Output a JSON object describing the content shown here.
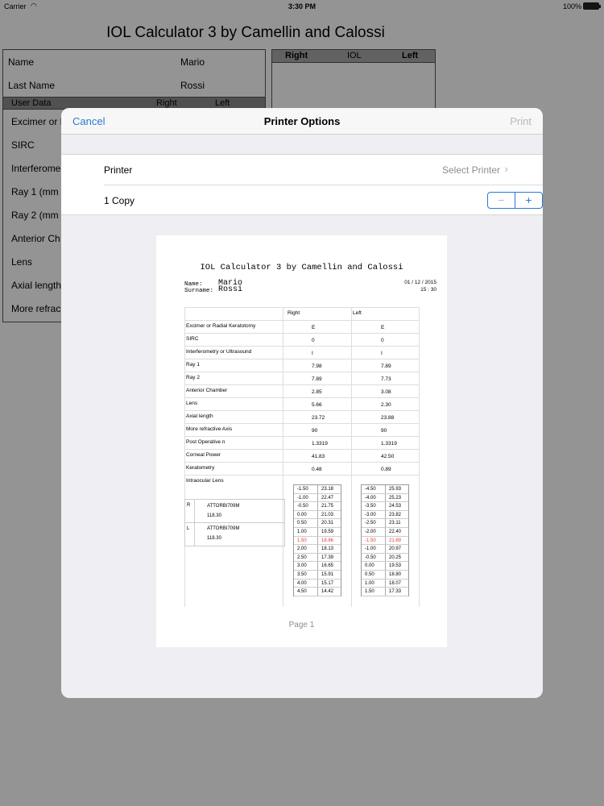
{
  "status": {
    "carrier": "Carrier",
    "time": "3:30 PM",
    "battery": "100%"
  },
  "app": {
    "title": "IOL Calculator 3 by Camellin and Calossi",
    "name_label": "Name",
    "name_value": "Mario",
    "lastname_label": "Last Name",
    "lastname_value": "Rossi",
    "header": {
      "user_data": "User Data",
      "right": "Right",
      "left": "Left"
    },
    "right_header": {
      "right": "Right",
      "iol": "IOL",
      "left": "Left"
    },
    "items": [
      "Excimer or R",
      "SIRC",
      "Interferome",
      "Ray 1 (mm",
      "Ray 2 (mm",
      "Anterior Ch",
      "Lens",
      "Axial length",
      "More refrac"
    ]
  },
  "modal": {
    "cancel": "Cancel",
    "title": "Printer Options",
    "print": "Print",
    "printer_label": "Printer",
    "printer_value": "Select Printer",
    "copies_label": "1 Copy",
    "minus": "−",
    "plus": "+"
  },
  "preview": {
    "title": "IOL Calculator 3 by Camellin and Calossi",
    "name_label": "Name:",
    "name_value": "Mario",
    "surname_label": "Surname:",
    "surname_value": "Rossi",
    "date": "01 / 12 / 2015",
    "time": "15 : 30",
    "col_right": "Right",
    "col_left": "Left",
    "rows": [
      {
        "name": "Excimer or Radial Keratotomy",
        "right": "E",
        "left": "E"
      },
      {
        "name": "SIRC",
        "right": "0",
        "left": "0"
      },
      {
        "name": "Interferometry or Ultrasound",
        "right": "I",
        "left": "I"
      },
      {
        "name": "Ray 1",
        "right": "7.98",
        "left": "7.89"
      },
      {
        "name": "Ray 2",
        "right": "7.89",
        "left": "7.73"
      },
      {
        "name": "Anterior Chamber",
        "right": "2.85",
        "left": "3.08"
      },
      {
        "name": "Lens",
        "right": "5.66",
        "left": "2.30"
      },
      {
        "name": "Axial length",
        "right": "23.72",
        "left": "23.88"
      },
      {
        "name": "More refractive Axis",
        "right": "90",
        "left": "90"
      },
      {
        "name": "Post Operative n",
        "right": "1.3319",
        "left": "1.3319"
      },
      {
        "name": "Corneal Power",
        "right": "41.83",
        "left": "42.50"
      },
      {
        "name": "Keratometry",
        "right": "0.48",
        "left": "0.89"
      }
    ],
    "iol_label": "Intraocular Lens",
    "lens_r_side": "R",
    "lens_r_name": "ATTORBI709M",
    "lens_r_value": "118.30",
    "lens_l_side": "L",
    "lens_l_name": "ATTORBI709M",
    "lens_l_value": "118.30",
    "right_table": [
      [
        "-1.50",
        "23.18"
      ],
      [
        "-1.00",
        "22.47"
      ],
      [
        "-0.50",
        "21.75"
      ],
      [
        "0.00",
        "21.03"
      ],
      [
        "0.50",
        "20.31"
      ],
      [
        "1.00",
        "19.59"
      ],
      [
        "1.50",
        "18.86"
      ],
      [
        "2.00",
        "18.13"
      ],
      [
        "2.50",
        "17.39"
      ],
      [
        "3.00",
        "16.65"
      ],
      [
        "3.50",
        "15.91"
      ],
      [
        "4.00",
        "15.17"
      ],
      [
        "4.50",
        "14.42"
      ]
    ],
    "left_table": [
      [
        "-4.50",
        "25.93"
      ],
      [
        "-4.00",
        "25.23"
      ],
      [
        "-3.50",
        "24.53"
      ],
      [
        "-3.00",
        "23.82"
      ],
      [
        "-2.50",
        "23.11"
      ],
      [
        "-2.00",
        "22.40"
      ],
      [
        "-1.50",
        "21.69"
      ],
      [
        "-1.00",
        "20.97"
      ],
      [
        "-0.50",
        "20.25"
      ],
      [
        "0.00",
        "19.53"
      ],
      [
        "0.50",
        "18.80"
      ],
      [
        "1.00",
        "18.07"
      ],
      [
        "1.50",
        "17.33"
      ]
    ],
    "highlight_row": 6,
    "page_label": "Page 1"
  }
}
